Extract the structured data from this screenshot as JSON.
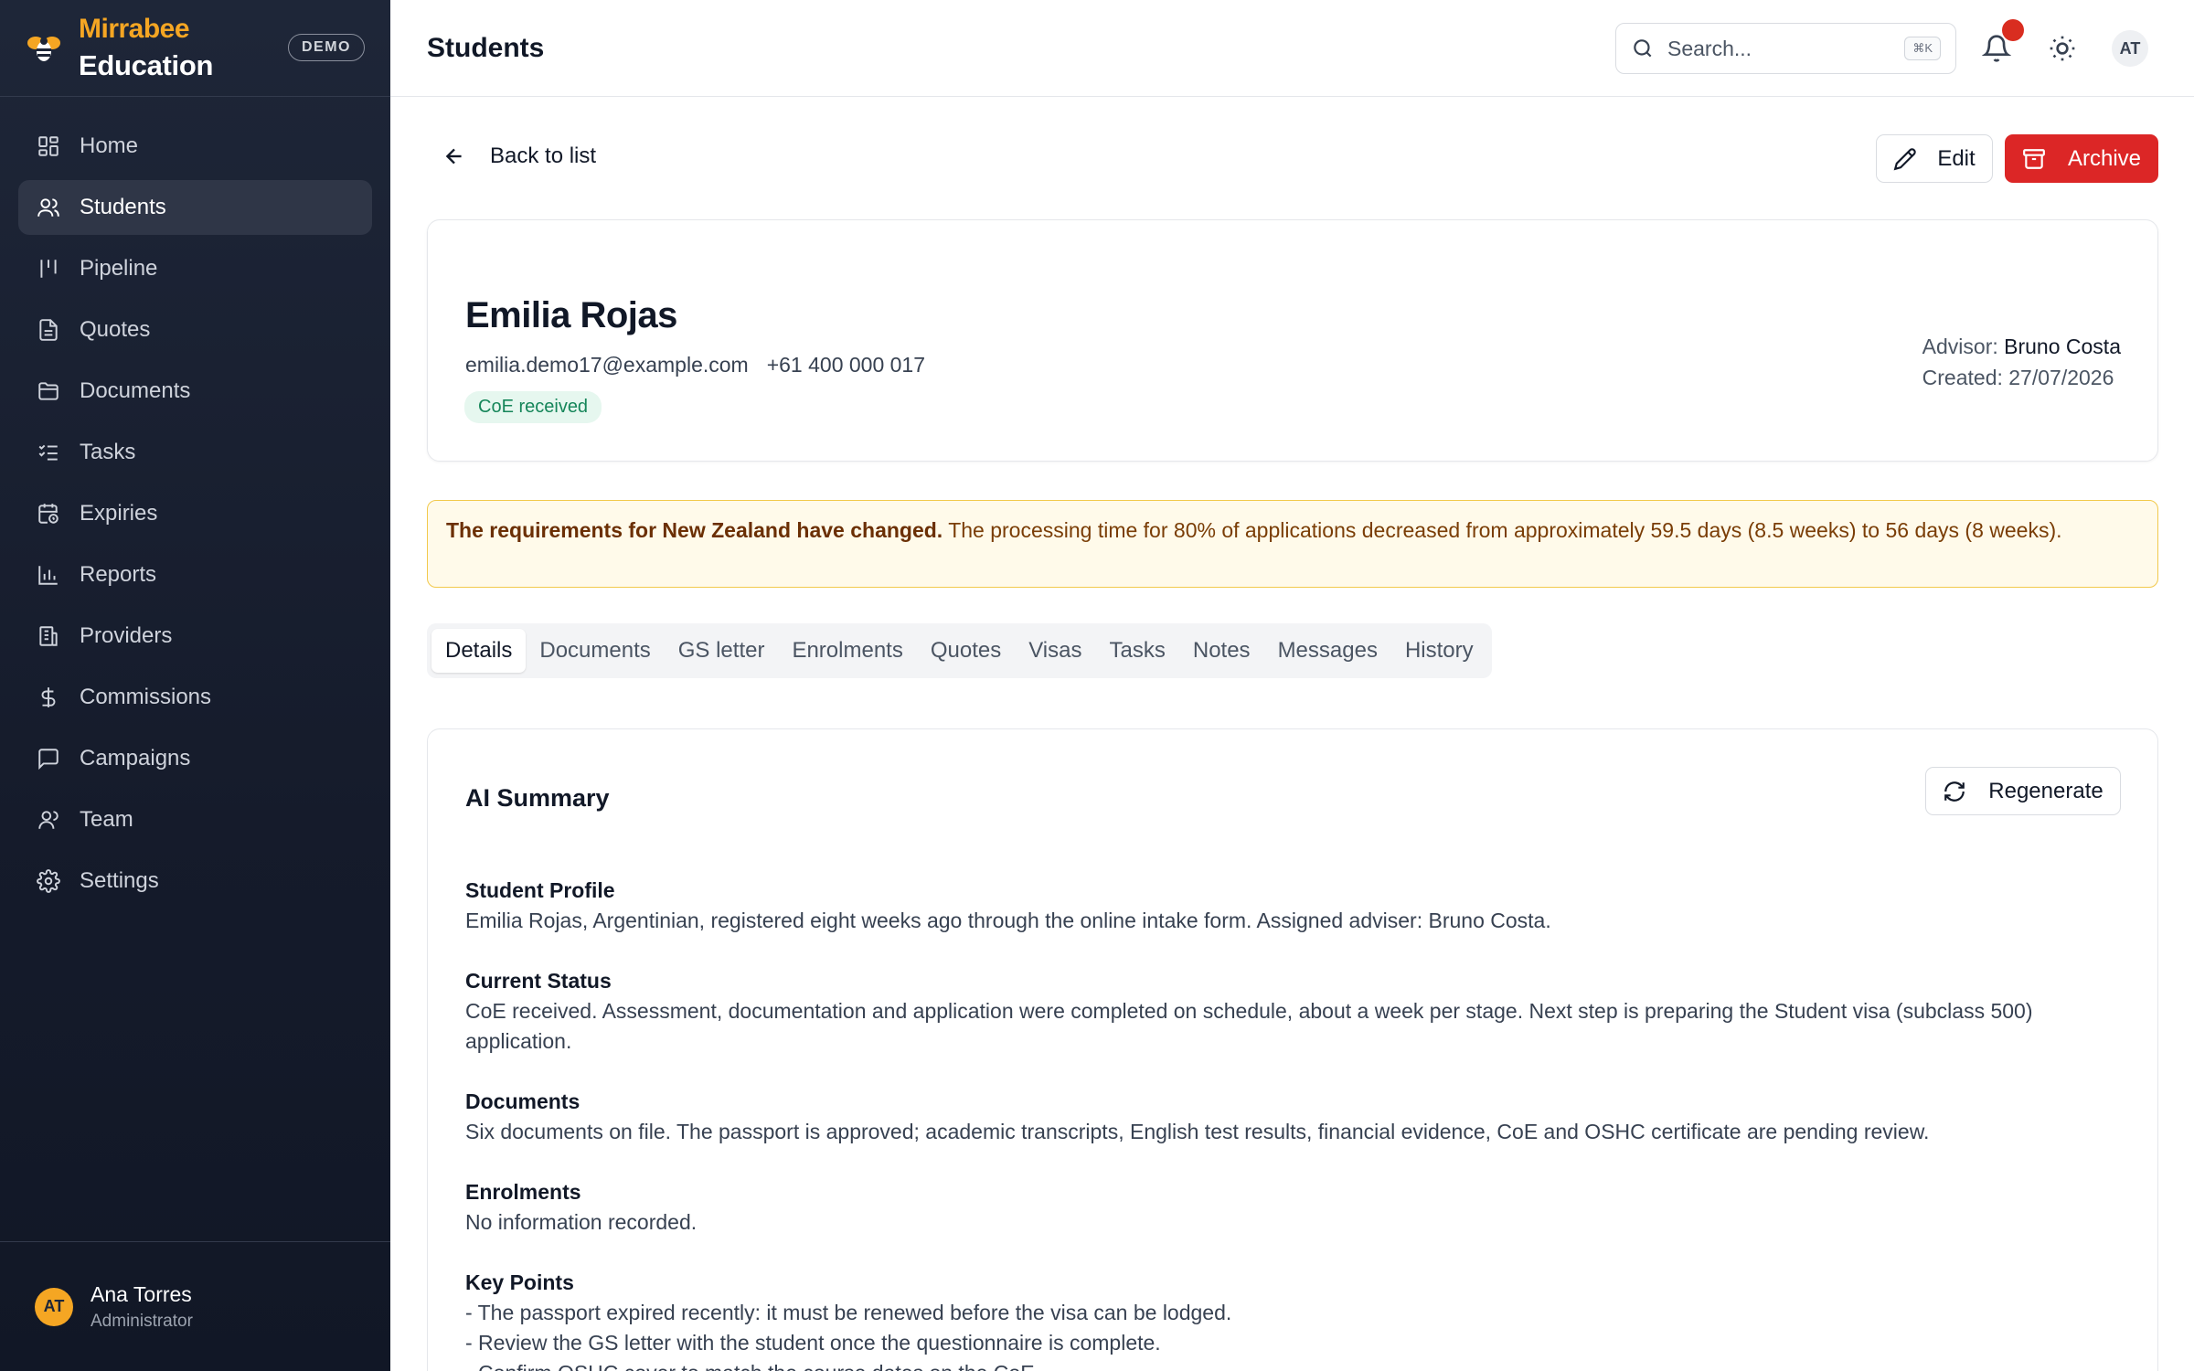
{
  "brand": {
    "name_top": "Mirrabee",
    "name_bottom": "Education",
    "badge": "DEMO",
    "accent": "#f5a623"
  },
  "sidebar": {
    "items": [
      {
        "label": "Home",
        "icon": "grid-icon"
      },
      {
        "label": "Students",
        "icon": "users-icon",
        "active": true
      },
      {
        "label": "Pipeline",
        "icon": "pipeline-icon"
      },
      {
        "label": "Quotes",
        "icon": "file-text-icon"
      },
      {
        "label": "Documents",
        "icon": "folder-icon"
      },
      {
        "label": "Tasks",
        "icon": "checklist-icon"
      },
      {
        "label": "Expiries",
        "icon": "calendar-clock-icon"
      },
      {
        "label": "Reports",
        "icon": "bar-chart-icon"
      },
      {
        "label": "Providers",
        "icon": "building-icon"
      },
      {
        "label": "Commissions",
        "icon": "dollar-icon"
      },
      {
        "label": "Campaigns",
        "icon": "message-square-icon"
      },
      {
        "label": "Team",
        "icon": "user-icon"
      },
      {
        "label": "Settings",
        "icon": "gear-icon"
      }
    ],
    "user": {
      "initials": "AT",
      "name": "Ana Torres",
      "role": "Administrator"
    }
  },
  "header": {
    "title": "Students",
    "search_placeholder": "Search...",
    "search_shortcut": "⌘K",
    "avatar_initials": "AT"
  },
  "toolbar": {
    "back_label": "Back to list",
    "edit_label": "Edit",
    "archive_label": "Archive",
    "archive_color": "#dc2626"
  },
  "student": {
    "name": "Emilia Rojas",
    "email": "emilia.demo17@example.com",
    "phone": "+61 400 000 017",
    "status": "CoE received",
    "advisor_label": "Advisor:",
    "advisor": "Bruno Costa",
    "created": "Created: 27/07/2026"
  },
  "alert": {
    "title": "The requirements for New Zealand have changed.",
    "text": "The processing time for 80% of applications decreased from approximately 59.5 days (8.5 weeks) to 56 days (8 weeks)."
  },
  "tabs": [
    "Details",
    "Documents",
    "GS letter",
    "Enrolments",
    "Quotes",
    "Visas",
    "Tasks",
    "Notes",
    "Messages",
    "History"
  ],
  "summary": {
    "title": "AI Summary",
    "regenerate_label": "Regenerate",
    "sections": [
      {
        "heading": "Student Profile",
        "lines": [
          "Emilia Rojas, Argentinian, registered eight weeks ago through the online intake form. Assigned adviser: Bruno Costa."
        ]
      },
      {
        "heading": "Current Status",
        "lines": [
          "CoE received. Assessment, documentation and application were completed on schedule, about a week per stage. Next step is preparing the Student visa (subclass 500) application."
        ]
      },
      {
        "heading": "Documents",
        "lines": [
          "Six documents on file. The passport is approved; academic transcripts, English test results, financial evidence, CoE and OSHC certificate are pending review."
        ]
      },
      {
        "heading": "Enrolments",
        "lines": [
          "No information recorded."
        ]
      },
      {
        "heading": "Key Points",
        "lines": [
          "- The passport expired recently: it must be renewed before the visa can be lodged.",
          "- Review the GS letter with the student once the questionnaire is complete.",
          "- Confirm OSHC cover to match the course dates on the CoE."
        ]
      }
    ]
  }
}
